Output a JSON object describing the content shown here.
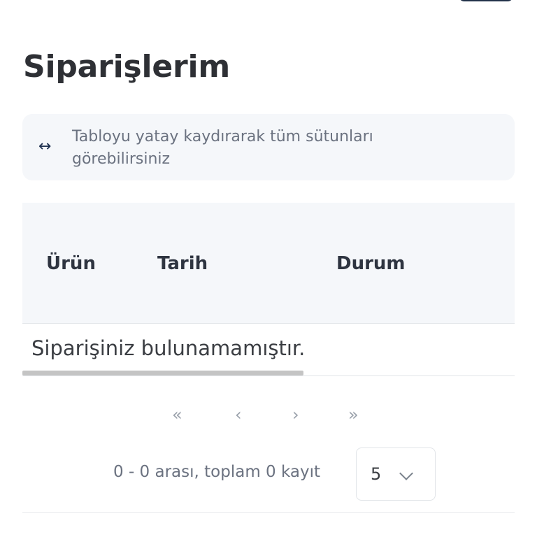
{
  "page": {
    "title": "Siparişlerim"
  },
  "hint": {
    "icon": "↔",
    "text": "Tabloyu yatay kaydırarak tüm sütunları görebilirsiniz"
  },
  "table": {
    "columns": [
      "Ürün",
      "Tarih",
      "Durum"
    ],
    "empty_message": "Siparişiniz bulunamamıştır."
  },
  "pagination": {
    "first": "«",
    "prev": "‹",
    "next": "›",
    "last": "»",
    "summary": "0 - 0 arası, toplam 0 kayıt",
    "page_size": "5"
  }
}
